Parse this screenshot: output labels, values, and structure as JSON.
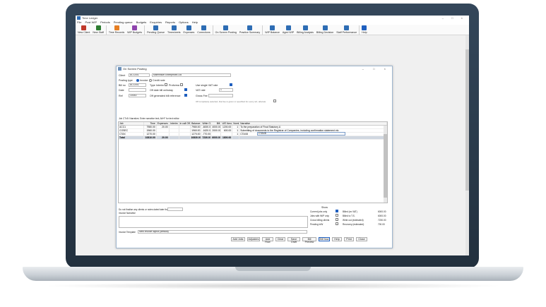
{
  "app": {
    "title": "Time Ledger",
    "window_controls": "– □ ×",
    "menu": [
      "File",
      "Post WIP",
      "Periods",
      "Pending queue",
      "Budgets",
      "Enquiries",
      "Reports",
      "Options",
      "Help"
    ],
    "ribbon": [
      {
        "label": "New Client",
        "icon": "new-client-icon",
        "color": "#c0392b"
      },
      {
        "label": "New Staff",
        "icon": "new-staff-icon",
        "color": "#2e7d32"
      },
      {
        "label": "Time Records",
        "icon": "time-records-icon",
        "color": "#e67e22"
      },
      {
        "label": "WIP Budgets",
        "icon": "wip-budgets-icon",
        "color": "#8e44ad"
      },
      {
        "label": "Pending Queue",
        "icon": "pending-queue-icon",
        "color": "#2e6db4"
      },
      {
        "label": "Timesheets",
        "icon": "timesheets-icon",
        "color": "#2e6db4"
      },
      {
        "label": "Expenses",
        "icon": "expenses-icon",
        "color": "#2e6db4"
      },
      {
        "label": "Corrections",
        "icon": "corrections-icon",
        "color": "#2e6db4"
      },
      {
        "label": "On Screen Posting",
        "icon": "on-screen-posting-icon",
        "color": "#2e6db4"
      },
      {
        "label": "Practice Summary",
        "icon": "practice-summary-icon",
        "color": "#2e6db4"
      },
      {
        "label": "WIP Balance",
        "icon": "wip-balance-icon",
        "color": "#2e6db4"
      },
      {
        "label": "Aged WIP",
        "icon": "aged-wip-icon",
        "color": "#2e6db4"
      },
      {
        "label": "Billing Analysis",
        "icon": "billing-analysis-icon",
        "color": "#2e6db4"
      },
      {
        "label": "Billing Decision",
        "icon": "billing-decision-icon",
        "color": "#2e6db4"
      },
      {
        "label": "Staff Performance",
        "icon": "staff-performance-icon",
        "color": "#2e6db4"
      },
      {
        "label": "Help",
        "icon": "help-icon",
        "color": "#1f5fbf"
      }
    ]
  },
  "dialog": {
    "title": "On Screen Posting",
    "controls": "– □ ×",
    "client_label": "Client",
    "client_code": "ACC001",
    "client_name": "Millennium Enterprises Ltd",
    "posting_type_label": "Posting type",
    "invoice_label": "Invoice",
    "credit_note_label": "Credit note",
    "billno_label": "Bill no",
    "billno_value": "ACC001",
    "type_label": "Type",
    "type_value": "Interim",
    "proforma_label": "Proforma",
    "single_vat_label": "Use single VAT rate",
    "date_label": "Date",
    "off_date_label": "Off date bill on/today",
    "vat_rate_label": "VAT rate",
    "vat_rate_value": "1",
    "ref_label": "Ref",
    "ref_value": "10043",
    "gross_fee_label": "Gross Fee",
    "gross_fee_value": "",
    "off_generated_label": "Off generated bill reference",
    "off_completely_note": "Off completely selected, that fee is given or specified for every wrt, allocate",
    "grid_caption": "Job CTx5: Narrative; Enter narrative text; Alt+F for text editor",
    "columns": [
      "Job",
      "Time",
      "Expenses",
      "Interim",
      "in call Off",
      "Balance",
      "Write Out",
      "Bill",
      "VAT Amount",
      "Nominal",
      "Narrative"
    ],
    "rows": [
      {
        "job": "ACC1",
        "time": "7980.00",
        "expenses": "20.00",
        "interim": "",
        "incall": "",
        "balance": "7980.00",
        "writeout": "-6000.00",
        "bill": "4000.00",
        "vat": "1200.00",
        "nominal": "1",
        "narrative": "To the preparation of Final Statutory A"
      },
      {
        "job": "COSEC",
        "time": "1960.00",
        "expenses": "",
        "interim": "",
        "incall": "",
        "balance": "1960.00",
        "writeout": "-1620.00",
        "bill": "2000.00",
        "vat": "600.00",
        "nominal": "1",
        "narrative": "Submitting of documents to the Registrar of Companies, including confirmation statement etc"
      },
      {
        "job": "CTAX",
        "time": "1270.00",
        "expenses": "",
        "interim": "",
        "incall": "",
        "balance": "1270.00",
        "writeout": "-770.00",
        "bill": "",
        "vat": "",
        "nominal": "1",
        "narrative": "CTAX8"
      },
      {
        "job": "Total",
        "time": "10810.00",
        "expenses": "20.00",
        "interim": "",
        "incall": "",
        "balance": "10830.00",
        "writeout": "7230.00",
        "bill": "6000.00",
        "vat": "1800.00",
        "nominal": "",
        "narrative": ""
      }
    ],
    "narr_edit_value": "CTAX8",
    "dont_finalise_label": "Do not finalise any clients or notes dated later than",
    "invoice_narrative_label": "Invoice Narrative",
    "show_label": "Show",
    "show_options": [
      {
        "label": "Current jobs only",
        "checked": true
      },
      {
        "label": "Jobs with WIP only",
        "checked": false
      },
      {
        "label": "Cross billing clients",
        "checked": false
      },
      {
        "label": "Pending b/W",
        "checked": false
      }
    ],
    "totals": [
      {
        "label": "Billed (ex VAT)",
        "value": "6000.00"
      },
      {
        "label": "Billed to T.S.",
        "value": "6000.00"
      },
      {
        "label": "Write out (estimated)",
        "value": "7230.00"
      },
      {
        "label": "Recovery (estimated)",
        "value": "700.00"
      }
    ],
    "invoice_template_label": "Invoice Template",
    "invoice_template_value": "New invoice layout (default)",
    "buttons": [
      "Add Jobs",
      "Adjusters",
      "Add Row",
      "Clear",
      "Save Draft",
      "Bill Preview",
      "Bill Now",
      "Help",
      "Print",
      "Close"
    ]
  }
}
